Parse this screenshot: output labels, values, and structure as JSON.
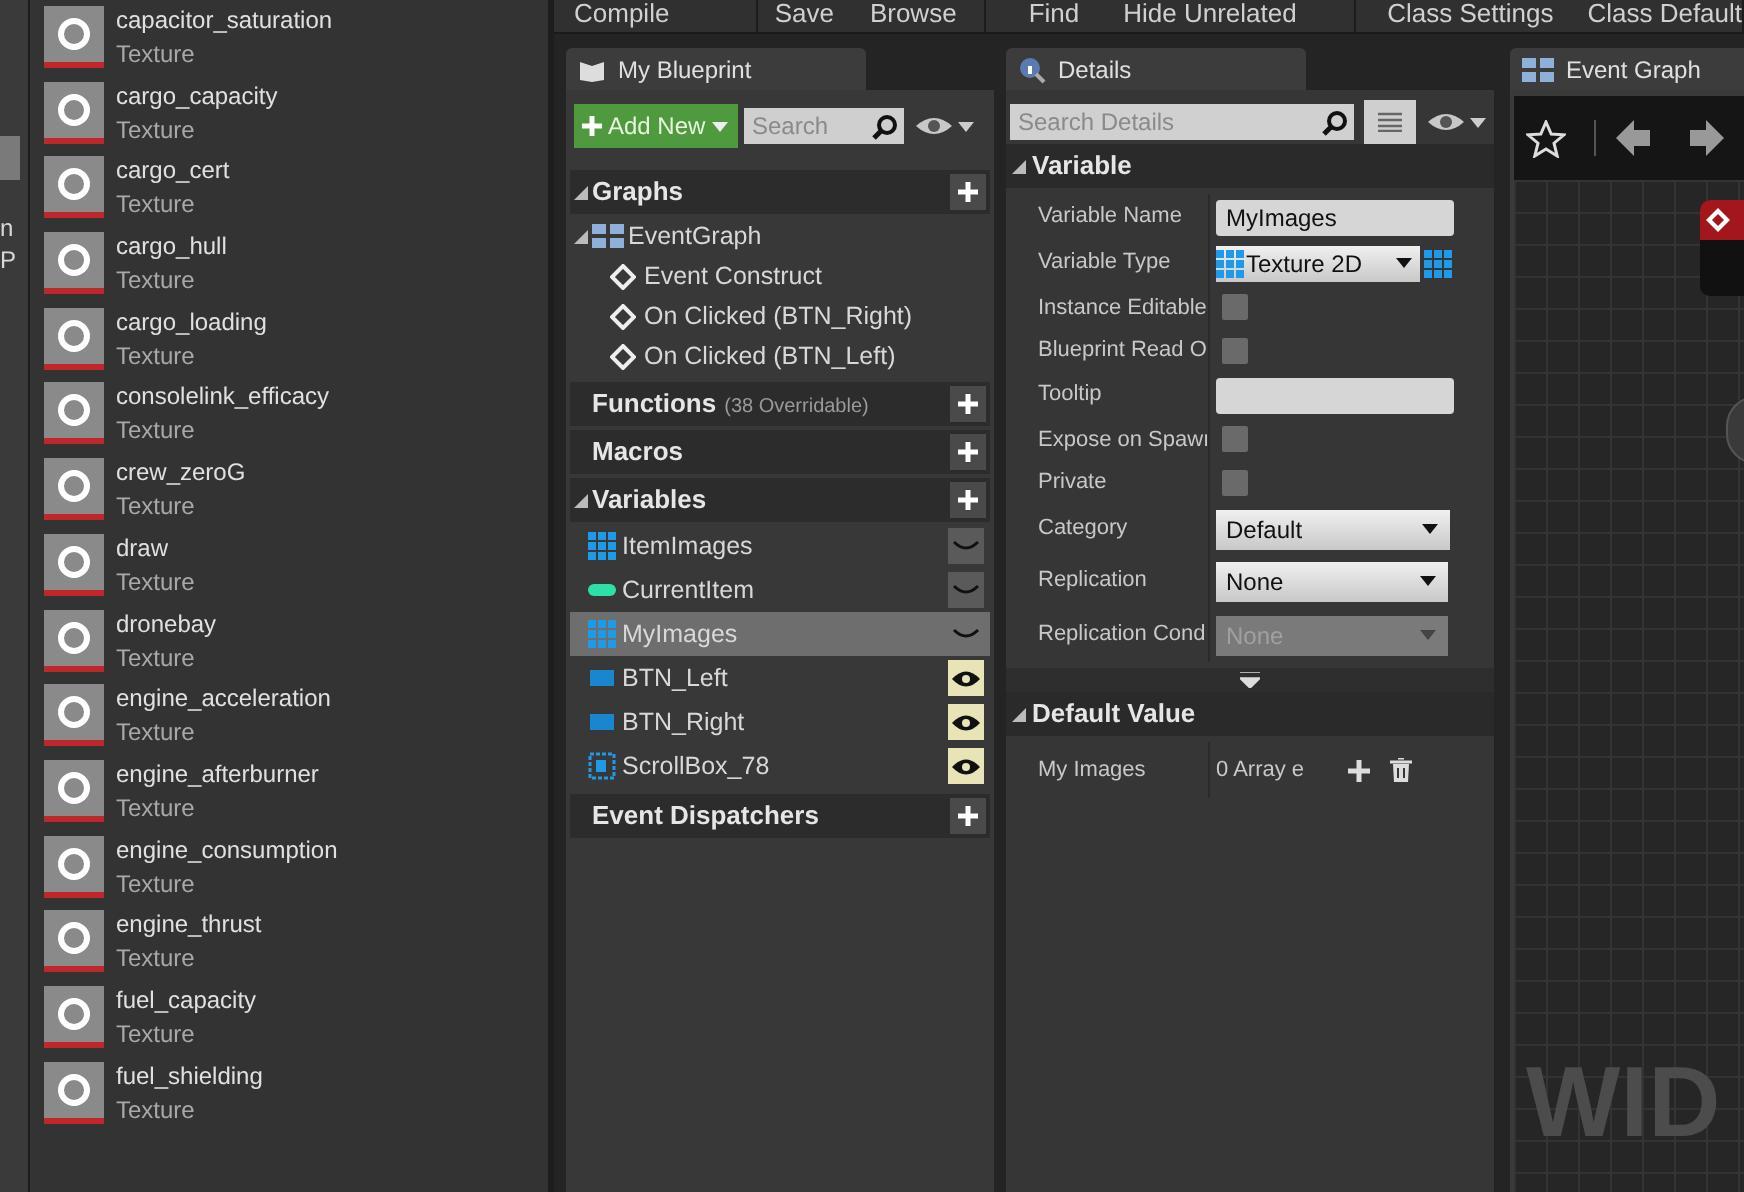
{
  "left_edge": {
    "texts": [
      "n",
      "P"
    ]
  },
  "assets": [
    {
      "name": "capacitor_saturation",
      "type": "Texture"
    },
    {
      "name": "cargo_capacity",
      "type": "Texture"
    },
    {
      "name": "cargo_cert",
      "type": "Texture"
    },
    {
      "name": "cargo_hull",
      "type": "Texture"
    },
    {
      "name": "cargo_loading",
      "type": "Texture"
    },
    {
      "name": "consolelink_efficacy",
      "type": "Texture"
    },
    {
      "name": "crew_zeroG",
      "type": "Texture"
    },
    {
      "name": "draw",
      "type": "Texture"
    },
    {
      "name": "dronebay",
      "type": "Texture"
    },
    {
      "name": "engine_acceleration",
      "type": "Texture"
    },
    {
      "name": "engine_afterburner",
      "type": "Texture"
    },
    {
      "name": "engine_consumption",
      "type": "Texture"
    },
    {
      "name": "engine_thrust",
      "type": "Texture"
    },
    {
      "name": "fuel_capacity",
      "type": "Texture"
    },
    {
      "name": "fuel_shielding",
      "type": "Texture"
    }
  ],
  "toolbar": [
    [
      "Compile"
    ],
    [
      "Save",
      "Browse"
    ],
    [
      "Find",
      "Hide Unrelated"
    ],
    [
      "Class Settings",
      "Class Default"
    ]
  ],
  "my_blueprint": {
    "tab": "My Blueprint",
    "add_new": "Add New",
    "search_placeholder": "Search",
    "sections": [
      {
        "title": "Graphs",
        "expanded": true,
        "items": [
          {
            "label": "EventGraph",
            "children": [
              {
                "label": "Event Construct"
              },
              {
                "label": "On Clicked (BTN_Right)"
              },
              {
                "label": "On Clicked (BTN_Left)"
              }
            ]
          }
        ]
      },
      {
        "title": "Functions",
        "note": "(38 Overridable)",
        "expanded": false
      },
      {
        "title": "Macros",
        "expanded": false
      },
      {
        "title": "Variables",
        "expanded": true,
        "variables": [
          {
            "name": "ItemImages",
            "kind": "array",
            "selected": false,
            "public": false
          },
          {
            "name": "CurrentItem",
            "kind": "integer",
            "selected": false,
            "public": false
          },
          {
            "name": "MyImages",
            "kind": "array",
            "selected": true,
            "public": false
          },
          {
            "name": "BTN_Left",
            "kind": "widget",
            "selected": false,
            "public": true
          },
          {
            "name": "BTN_Right",
            "kind": "widget",
            "selected": false,
            "public": true
          },
          {
            "name": "ScrollBox_78",
            "kind": "scrollbox",
            "selected": false,
            "public": true
          }
        ]
      },
      {
        "title": "Event Dispatchers",
        "expanded": false
      }
    ]
  },
  "details": {
    "tab": "Details",
    "search_placeholder": "Search Details",
    "sections": [
      {
        "title": "Variable",
        "rows": [
          {
            "label": "Variable Name",
            "kind": "text",
            "value": "MyImages"
          },
          {
            "label": "Variable Type",
            "kind": "type",
            "value": "Texture 2D"
          },
          {
            "label": "Instance Editable",
            "kind": "checkbox",
            "checked": false
          },
          {
            "label": "Blueprint Read O",
            "kind": "checkbox",
            "checked": false
          },
          {
            "label": "Tooltip",
            "kind": "text"
          },
          {
            "label": "Expose on Spawı",
            "kind": "checkbox",
            "checked": false
          },
          {
            "label": "Private",
            "kind": "checkbox",
            "checked": false
          },
          {
            "label": "Category",
            "kind": "combo",
            "value": "Default",
            "disabled": false
          },
          {
            "label": "Replication",
            "kind": "dropdown",
            "value": "None",
            "disabled": false
          },
          {
            "label": "Replication Cond",
            "kind": "dropdown",
            "value": "None",
            "disabled": true
          }
        ],
        "more": true
      },
      {
        "title": "Default Value",
        "rows": [
          {
            "label": "My Images",
            "kind": "array",
            "value": "0 Array e"
          }
        ]
      }
    ]
  },
  "graph": {
    "tab": "Event Graph",
    "watermark": "WID"
  }
}
